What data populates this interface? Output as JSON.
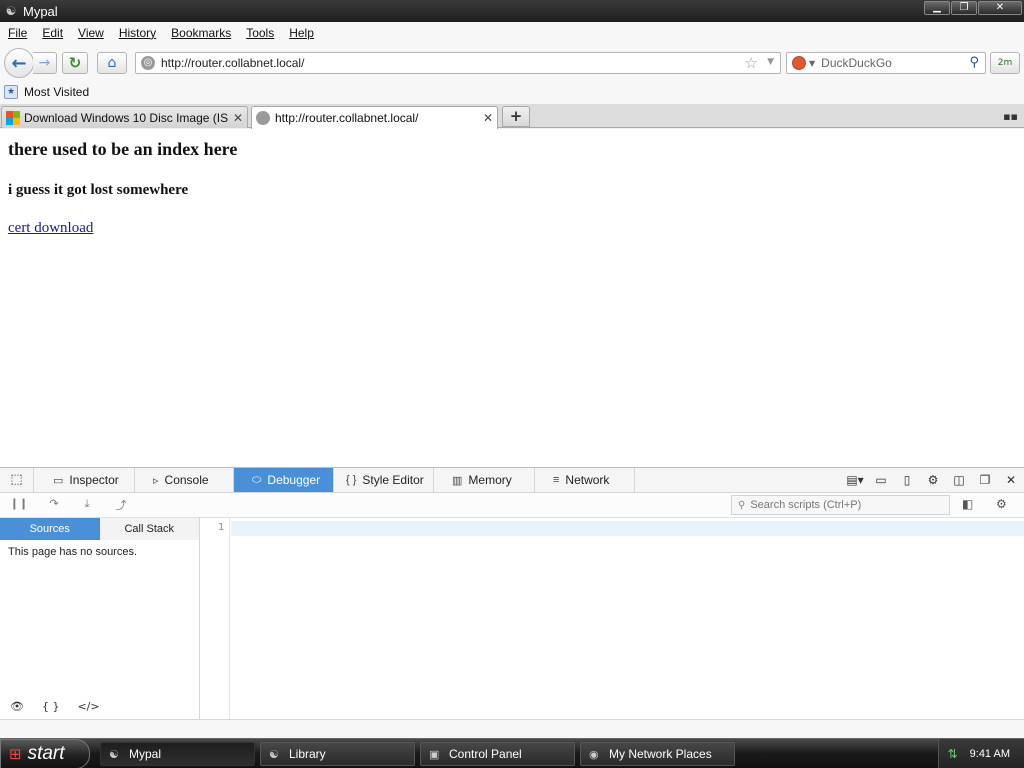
{
  "window": {
    "title": "Mypal",
    "minimize": "▁",
    "maximize": "❐",
    "close": "✕"
  },
  "menu": [
    "File",
    "Edit",
    "View",
    "History",
    "Bookmarks",
    "Tools",
    "Help"
  ],
  "nav": {
    "back": "←",
    "forward": "→",
    "reload": "↻",
    "home": "⌂",
    "url": "http://router.collabnet.local/",
    "search_placeholder": "DuckDuckGo",
    "addon": "2m"
  },
  "bookmarks": {
    "most_visited": "Most Visited"
  },
  "tabs": [
    {
      "label": "Download Windows 10 Disc Image (IS...",
      "close": "✕"
    },
    {
      "label": "http://router.collabnet.local/",
      "close": "✕"
    }
  ],
  "page": {
    "heading": "there used to be an index here",
    "subheading": "i guess it got lost somewhere",
    "link": "cert download"
  },
  "devtools": {
    "tabs": [
      {
        "label": "Inspector",
        "icon": "▭"
      },
      {
        "label": "Console",
        "icon": "▹"
      },
      {
        "label": "Debugger",
        "icon": "⬭"
      },
      {
        "label": "Style Editor",
        "icon": "{ }"
      },
      {
        "label": "Memory",
        "icon": "▥"
      },
      {
        "label": "Network",
        "icon": "≡"
      }
    ],
    "active_tab": "Debugger",
    "search_placeholder": "Search scripts (Ctrl+P)",
    "source_tabs": [
      "Sources",
      "Call Stack"
    ],
    "no_sources": "This page has no sources.",
    "line_number": "1",
    "accent": "#4a90d9"
  },
  "taskbar": {
    "start": "start",
    "tasks": [
      "Mypal",
      "Library",
      "Control Panel",
      "My Network Places"
    ],
    "clock": "9:41 AM"
  }
}
